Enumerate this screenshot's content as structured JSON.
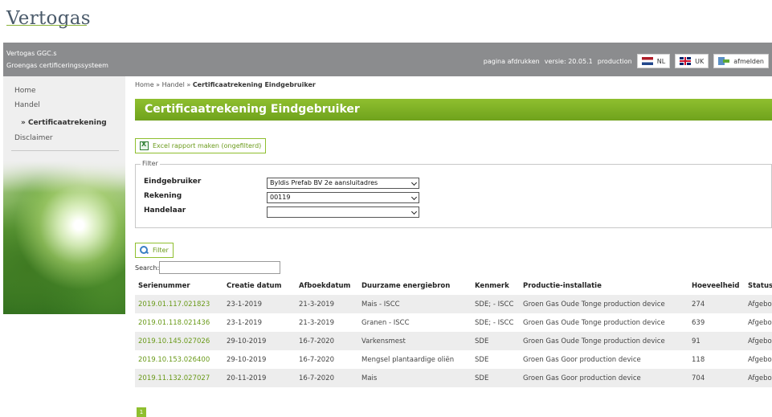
{
  "logo": {
    "text": "Vertogas"
  },
  "topbar": {
    "brand_line1": "Vertogas GGC.s",
    "brand_line2": "Groengas certificeringssysteem",
    "print_label": "pagina afdrukken",
    "version_label": "versie: 20.05.1",
    "env_label": "production",
    "lang_nl": "NL",
    "lang_uk": "UK",
    "logout_label": "afmelden"
  },
  "sidebar": {
    "items": [
      {
        "label": "Home"
      },
      {
        "label": "Handel"
      },
      {
        "label": "» Certificaatrekening"
      },
      {
        "label": "Disclaimer"
      }
    ]
  },
  "breadcrumb": {
    "home": "Home",
    "sep1": " » ",
    "handel": "Handel",
    "sep2": " » ",
    "current": "Certificaatrekening Eindgebruiker"
  },
  "page_title": "Certificaatrekening Eindgebruiker",
  "excel_button": "Excel rapport maken (ongefilterd)",
  "filter": {
    "legend": "Filter",
    "fields": [
      {
        "label": "Eindgebruiker",
        "value": "Byldis Prefab BV 2e aansluitadres"
      },
      {
        "label": "Rekening",
        "value": "00119"
      },
      {
        "label": "Handelaar",
        "value": ""
      }
    ],
    "button": "Filter"
  },
  "search": {
    "label": "Search:",
    "value": ""
  },
  "table": {
    "headers": [
      "Serienummer",
      "Creatie datum",
      "Afboekdatum",
      "Duurzame energiebron",
      "Kenmerk",
      "Productie-installatie",
      "Hoeveelheid",
      "Status"
    ],
    "rows": [
      [
        "2019.01.117.021823",
        "23-1-2019",
        "21-3-2019",
        "Mais - ISCC",
        "SDE; - ISCC",
        "Groen Gas Oude Tonge production device",
        "274",
        "Afgeboekt"
      ],
      [
        "2019.01.118.021436",
        "23-1-2019",
        "21-3-2019",
        "Granen - ISCC",
        "SDE; - ISCC",
        "Groen Gas Oude Tonge production device",
        "639",
        "Afgeboekt"
      ],
      [
        "2019.10.145.027026",
        "29-10-2019",
        "16-7-2020",
        "Varkensmest",
        "SDE",
        "Groen Gas Oude Tonge production device",
        "91",
        "Afgeboekt"
      ],
      [
        "2019.10.153.026400",
        "29-10-2019",
        "16-7-2020",
        "Mengsel plantaardige oliën",
        "SDE",
        "Groen Gas Goor production device",
        "118",
        "Afgeboekt"
      ],
      [
        "2019.11.132.027027",
        "20-11-2019",
        "16-7-2020",
        "Mais",
        "SDE",
        "Groen Gas Goor production device",
        "704",
        "Afgeboekt"
      ]
    ]
  },
  "pager": {
    "current_page": "1"
  },
  "colors": {
    "accent": "#8fbf2f",
    "topbar": "#8b8c8e",
    "sidebar": "#efefef"
  }
}
